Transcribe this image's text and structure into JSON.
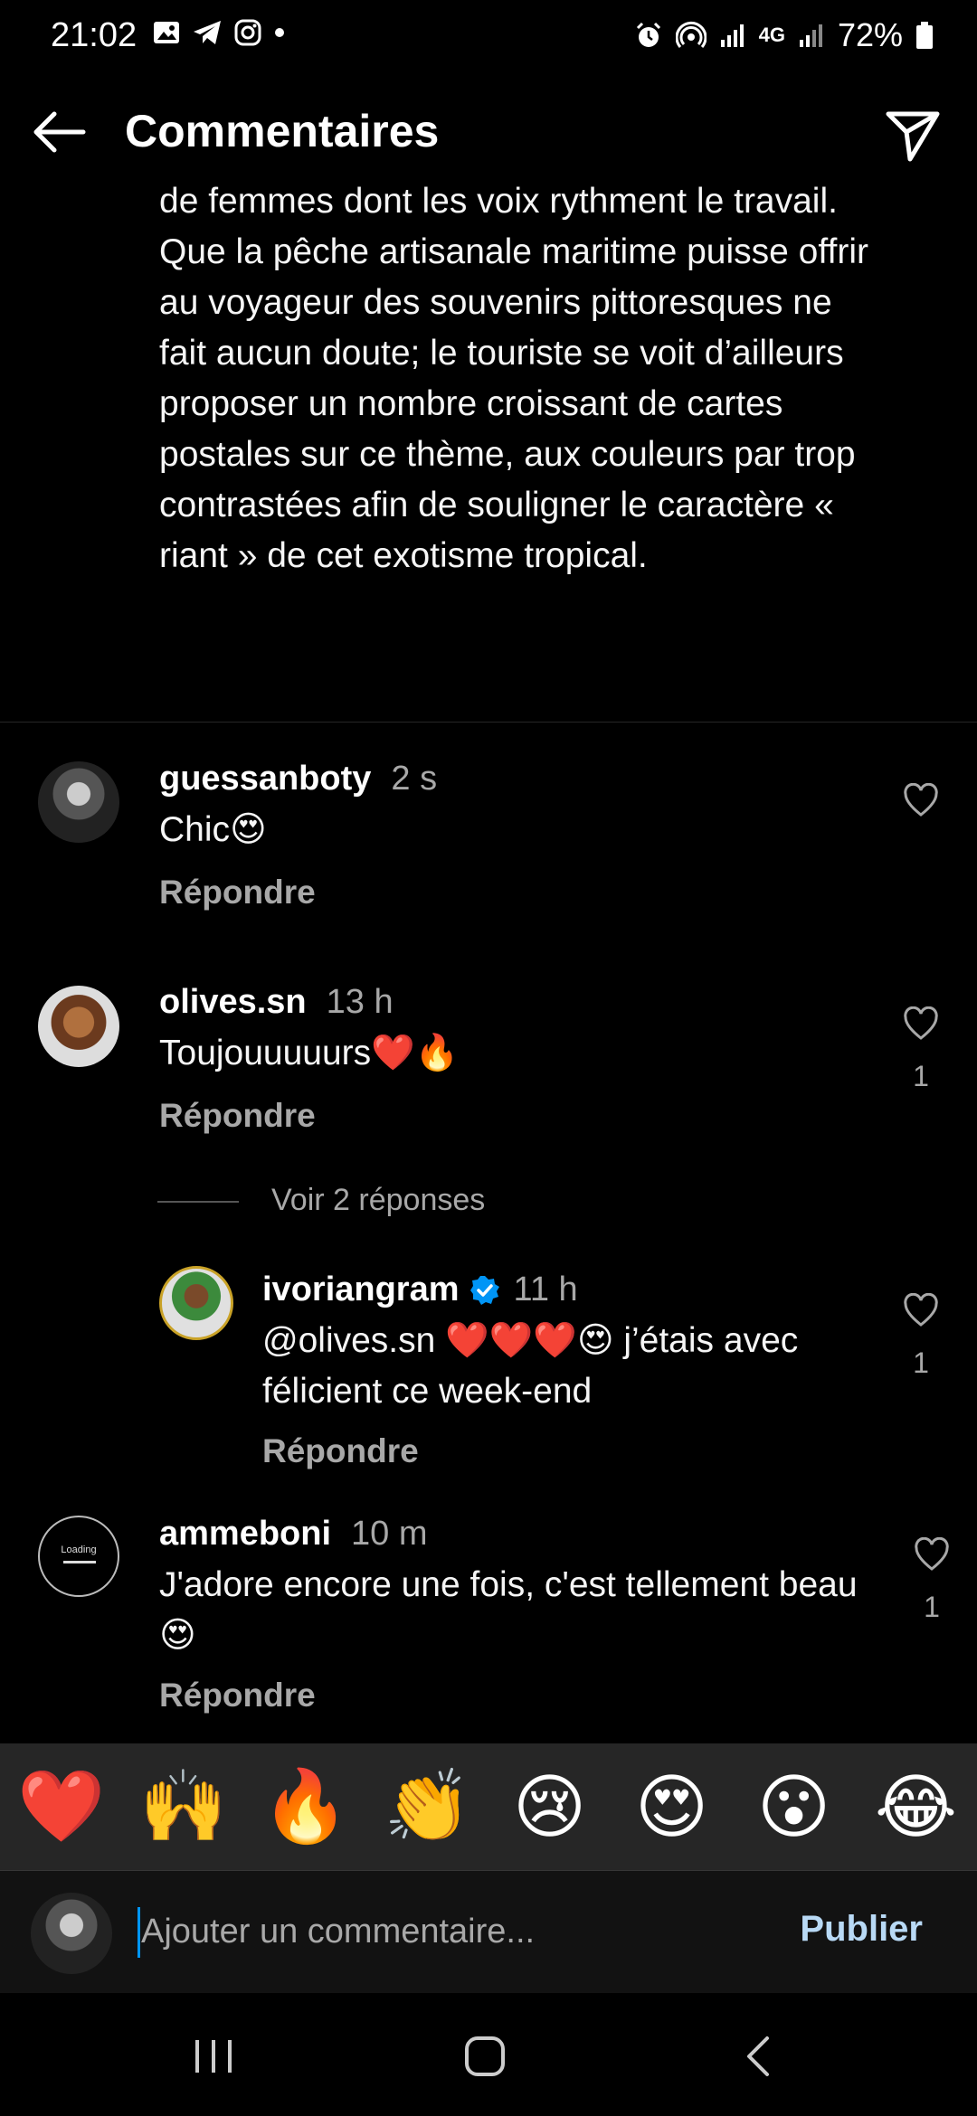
{
  "status": {
    "time": "21:02",
    "network": "4G",
    "battery": "72%"
  },
  "header": {
    "title": "Commentaires"
  },
  "caption": {
    "lines_top": "de femmes dont les voix rythment le travail.",
    "paragraph": "Que la pêche artisanale maritime puisse offrir au voyageur des souvenirs pittoresques ne fait aucun doute; le touriste se voit d’ailleurs proposer un nombre croissant de cartes postales sur ce thème, aux couleurs par trop contrastées afin de souligner le caractère « riant » de cet exotisme tropical."
  },
  "comments": [
    {
      "username": "guessanboty",
      "time": "2 s",
      "text": "Chic😍",
      "reply": "Répondre",
      "likes": ""
    },
    {
      "username": "olives.sn",
      "time": "13 h",
      "text": "Toujouuuuurs❤️🔥",
      "reply": "Répondre",
      "likes": "1"
    },
    {
      "username": "ivoriangram",
      "time": "11 h",
      "text": "@olives.sn ❤️❤️❤️😍 j’étais avec félicient ce week-end",
      "reply": "Répondre",
      "likes": "1",
      "verified": true
    },
    {
      "username": "ammeboni",
      "time": "10 m",
      "text": "J'adore encore une fois, c'est tellement beau 😍",
      "reply": "Répondre",
      "likes": "1",
      "avatar_text": "Loading"
    }
  ],
  "view_replies": "Voir 2 réponses",
  "reactions": [
    "❤️",
    "🙌",
    "🔥",
    "👏",
    "😢",
    "😍",
    "😮",
    "😂"
  ],
  "composer": {
    "placeholder": "Ajouter un commentaire...",
    "publish": "Publier"
  },
  "colors": {
    "background": "#000000",
    "muted_text": "#a8a8a8",
    "verified": "#0095f6",
    "publish": "#b8d9f5"
  }
}
